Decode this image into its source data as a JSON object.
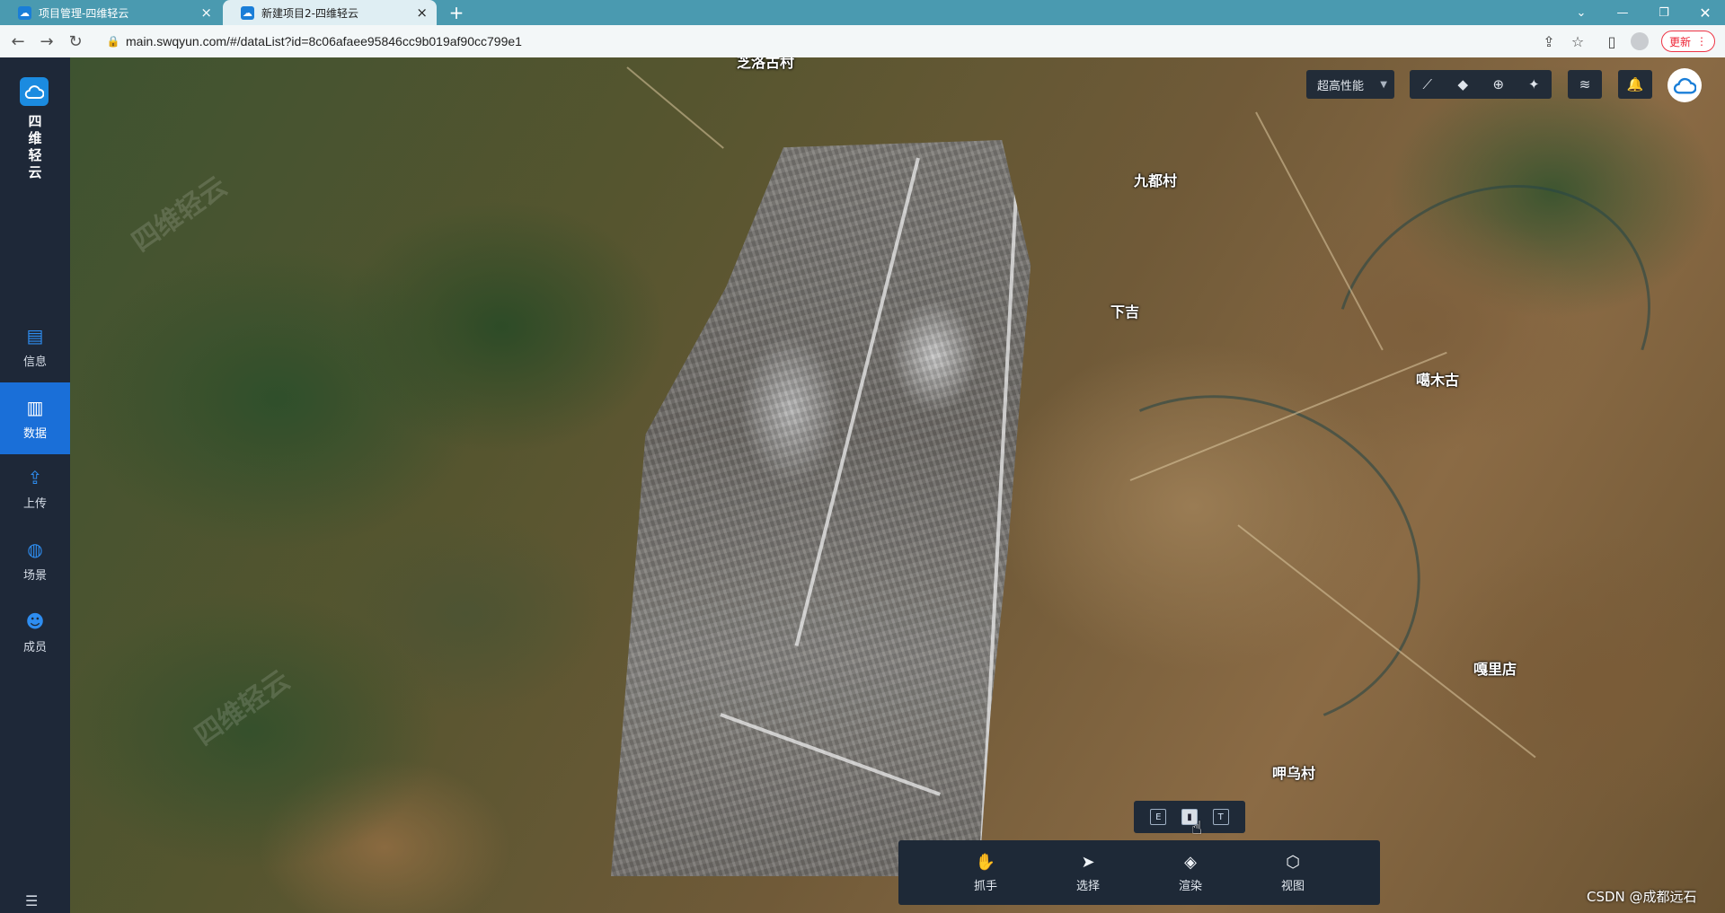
{
  "browser": {
    "tabs": [
      {
        "title": "项目管理-四维轻云",
        "active": false
      },
      {
        "title": "新建项目2-四维轻云",
        "active": true
      }
    ],
    "url": "main.swqyun.com/#/dataList?id=8c06afaee95846cc9b019af90cc799e1",
    "update_label": "更新"
  },
  "sidebar": {
    "brand": "四维轻云",
    "items": [
      {
        "label": "信息",
        "icon": "document-icon",
        "active": false
      },
      {
        "label": "数据",
        "icon": "data-icon",
        "active": true
      },
      {
        "label": "上传",
        "icon": "upload-icon",
        "active": false
      },
      {
        "label": "场景",
        "icon": "globe-icon",
        "active": false
      },
      {
        "label": "成员",
        "icon": "members-icon",
        "active": false
      }
    ]
  },
  "map": {
    "places": [
      "芝洛古村",
      "九都村",
      "下吉",
      "噶木古",
      "嘎里店",
      "呷乌村"
    ],
    "watermark": "四维轻云"
  },
  "toolbar": {
    "performance": "超高性能"
  },
  "bottom_toolbar": {
    "items": [
      {
        "label": "抓手",
        "icon": "hand-icon"
      },
      {
        "label": "选择",
        "icon": "pointer-icon"
      },
      {
        "label": "渲染",
        "icon": "paint-bucket-icon"
      },
      {
        "label": "视图",
        "icon": "cube-icon"
      }
    ]
  },
  "footer": {
    "credit": "CSDN @成都远石"
  },
  "colors": {
    "accent": "#1a6fd8",
    "sidebar_bg": "#1e2838",
    "tab_bar": "#4a9ab0"
  }
}
